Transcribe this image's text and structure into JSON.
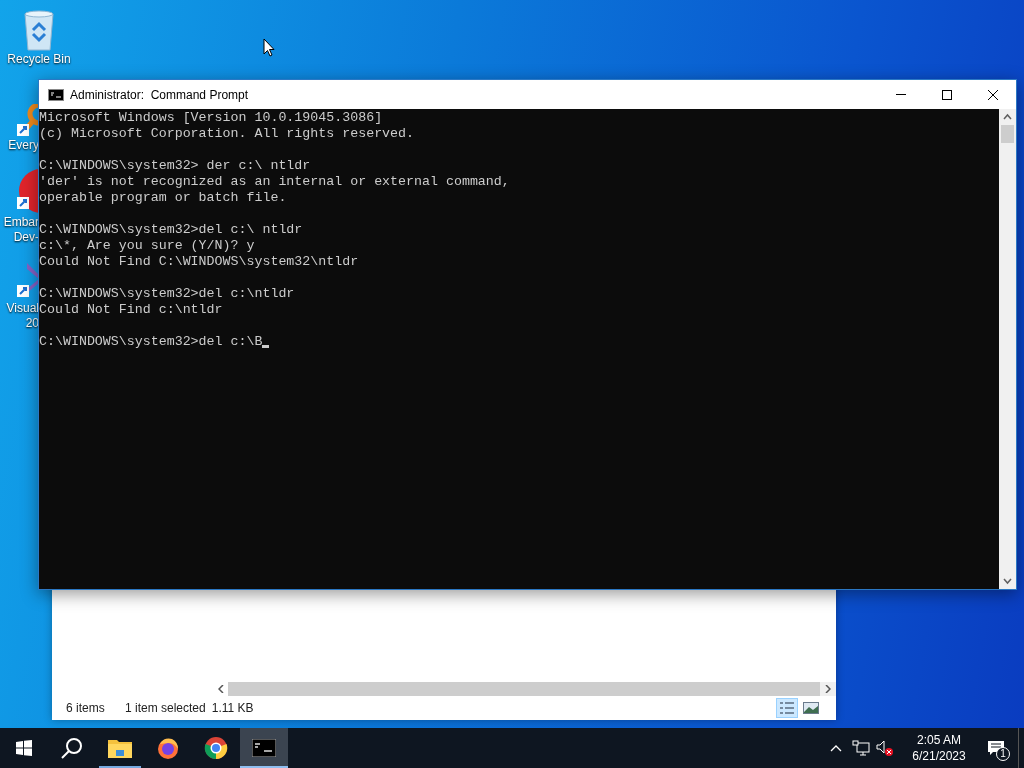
{
  "desktop_icons": [
    {
      "kind": "recycle",
      "labels": [
        "Recycle Bin"
      ]
    },
    {
      "kind": "search-app",
      "labels": [
        "Every"
      ]
    },
    {
      "kind": "red-app",
      "labels": [
        "Embar",
        "Dev-"
      ]
    },
    {
      "kind": "purple-app",
      "labels": [
        "Visual",
        "20"
      ]
    }
  ],
  "explorer_window": {
    "status_bar": {
      "item_count": "6 items",
      "selection": "1 item selected",
      "size": "1.11 KB"
    },
    "view_buttons": [
      {
        "kind": "details",
        "selected": true
      },
      {
        "kind": "large-icons",
        "selected": false
      }
    ]
  },
  "command_window": {
    "title": "Administrator:  Command Prompt",
    "blocks": [
      [
        "Microsoft Windows [Version 10.0.19045.3086]",
        "(c) Microsoft Corporation. All rights reserved."
      ],
      [
        "C:\\WINDOWS\\system32> der c:\\ ntldr",
        "'der' is not recognized as an internal or external command,",
        "operable program or batch file."
      ],
      [
        "C:\\WINDOWS\\system32>del c:\\ ntldr",
        "c:\\*, Are you sure (Y/N)? y",
        "Could Not Find C:\\WINDOWS\\system32\\ntldr"
      ],
      [
        "C:\\WINDOWS\\system32>del c:\\ntldr",
        "Could Not Find c:\\ntldr"
      ],
      [
        "C:\\WINDOWS\\system32>del c:\\B"
      ]
    ],
    "cursor": true
  },
  "taskbar": {
    "apps": [
      {
        "kind": "file-explorer",
        "running": true,
        "selected": false
      },
      {
        "kind": "firefox",
        "running": false,
        "selected": false
      },
      {
        "kind": "chrome",
        "running": false,
        "selected": false
      },
      {
        "kind": "terminal",
        "running": true,
        "selected": true
      }
    ],
    "tray": {
      "volume_muted": true,
      "time": "2:05 AM",
      "date": "6/21/2023",
      "notification_count": "1"
    }
  }
}
